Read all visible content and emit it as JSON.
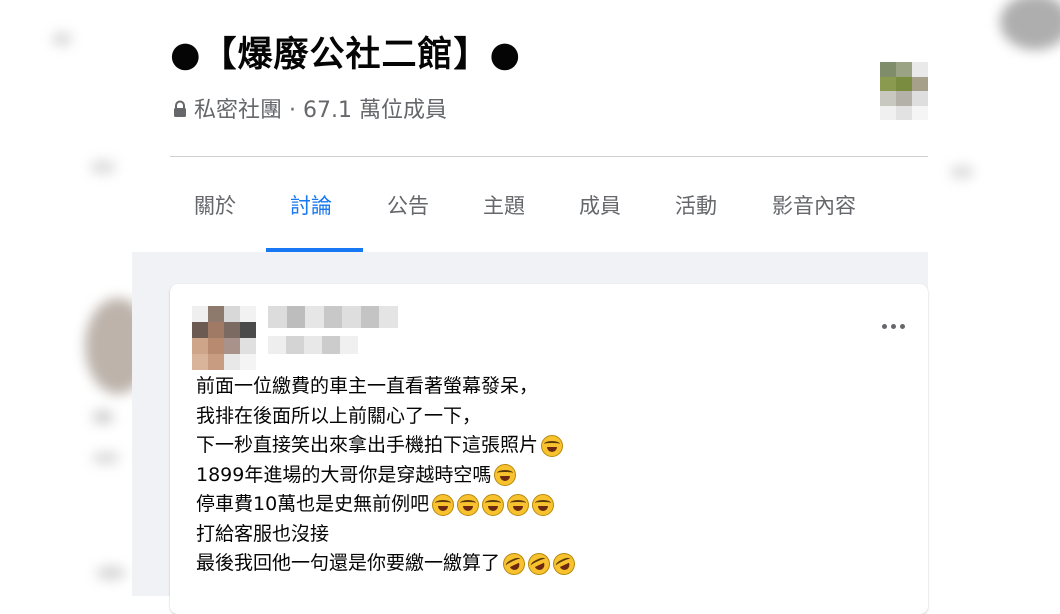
{
  "group": {
    "title": "●【爆廢公社二館】●",
    "meta": "私密社團 · 67.1 萬位成員"
  },
  "tabs": [
    "關於",
    "討論",
    "公告",
    "主題",
    "成員",
    "活動",
    "影音內容"
  ],
  "active_tab": "討論",
  "colors": {
    "accent": "#1877f2",
    "secondary_text": "#65676b",
    "feed_background": "#f0f2f5",
    "divider": "#ced0d4"
  },
  "post": {
    "author_name": "",
    "lines": [
      {
        "text": "前面一位繳費的車主一直看著螢幕發呆，",
        "emoji_count": 0,
        "emoji": ""
      },
      {
        "text": "我排在後面所以上前關心了一下，",
        "emoji_count": 0,
        "emoji": ""
      },
      {
        "text": "下一秒直接笑出來拿出手機拍下這張照片",
        "emoji_count": 1,
        "emoji": "face-with-tears-of-joy"
      },
      {
        "text": "1899年進場的大哥你是穿越時空嗎",
        "emoji_count": 1,
        "emoji": "face-with-tears-of-joy"
      },
      {
        "text": "停車費10萬也是史無前例吧",
        "emoji_count": 5,
        "emoji": "face-with-tears-of-joy"
      },
      {
        "text": "打給客服也沒接",
        "emoji_count": 0,
        "emoji": ""
      },
      {
        "text": "最後我回他一句還是你要繳一繳算了",
        "emoji_count": 3,
        "emoji": "rolling-on-floor-laughing"
      }
    ]
  },
  "icons": {
    "lock": "lock-icon",
    "more": "more-options-icon"
  }
}
